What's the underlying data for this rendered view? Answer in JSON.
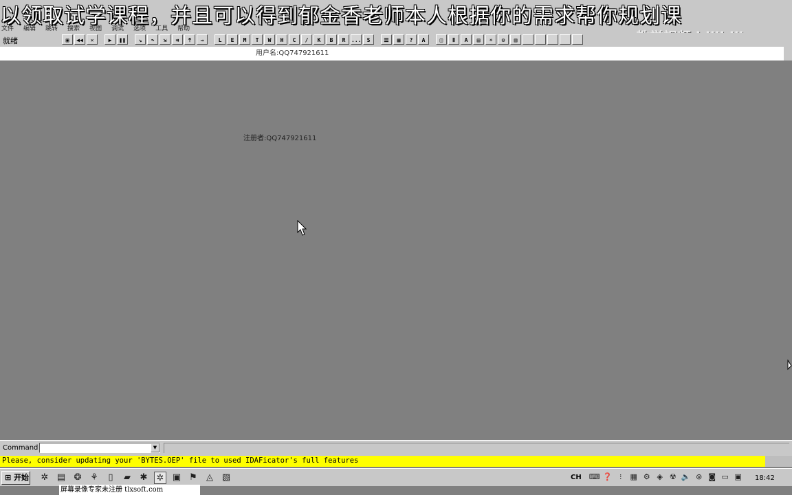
{
  "banner": {
    "text": "以领取试学课程，并且可以得到郁金香老师本人根据你的需求帮你规划课"
  },
  "menu": {
    "items": [
      "文件",
      "编辑",
      "跳转",
      "搜索",
      "视图",
      "调试",
      "选项",
      "工具",
      "帮助"
    ]
  },
  "watermark": {
    "text": "教学视频 bilibili"
  },
  "toolbar": {
    "status_label": "就绪",
    "buttons": [
      "L",
      "E",
      "M",
      "T",
      "W",
      "H",
      "C",
      "/",
      "K",
      "B",
      "R",
      "...",
      "S"
    ]
  },
  "userbar": {
    "user_text": "用户名:QQ747921611"
  },
  "main": {
    "reg_text": "注册者:QQ747921611"
  },
  "command": {
    "label": "Command",
    "value": ""
  },
  "message": {
    "text": "Please, consider updating your 'BYTES.OEP' file to used IDAFicator's full features"
  },
  "taskbar": {
    "start_label": "开始",
    "ime_label": "CH",
    "clock": "18:42"
  },
  "footer": {
    "note": "屏幕录像专家未注册 tlxsoft.com"
  },
  "colors": {
    "message_bg": "#ffff00",
    "workspace_bg": "#808080",
    "chrome_bg": "#c8c8c8"
  }
}
